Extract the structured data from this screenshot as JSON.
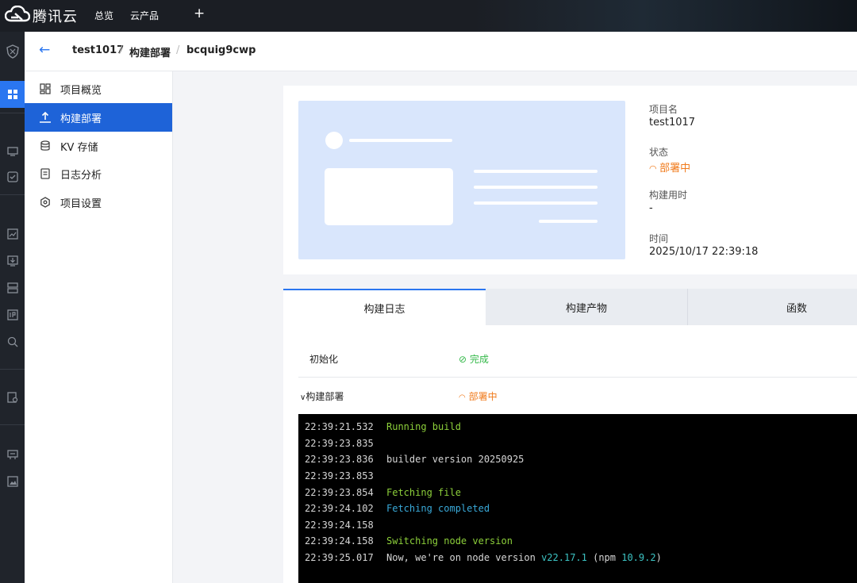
{
  "topbar": {
    "brand": "腾讯云",
    "nav": [
      "总览",
      "云产品"
    ],
    "plus": "+"
  },
  "header": {
    "breadcrumb": [
      "test1017",
      "构建部署",
      "bcquig9cwp"
    ]
  },
  "sidemenu": {
    "items": [
      {
        "label": "项目概览",
        "icon": "grid-icon"
      },
      {
        "label": "构建部署",
        "icon": "upload-icon",
        "active": true
      },
      {
        "label": "KV 存储",
        "icon": "database-icon"
      },
      {
        "label": "日志分析",
        "icon": "document-icon"
      },
      {
        "label": "项目设置",
        "icon": "gear-icon"
      }
    ]
  },
  "project": {
    "name_label": "项目名",
    "name_value": "test1017",
    "status_label": "状态",
    "status_value": "部署中",
    "build_time_label": "构建用时",
    "build_time_value": "-",
    "time_label": "时间",
    "time_value": "2025/10/17 22:39:18"
  },
  "tabs": [
    "构建日志",
    "构建产物",
    "函数"
  ],
  "stages": [
    {
      "name": "初始化",
      "status": "完成"
    },
    {
      "name": "构建部署",
      "status": "部署中"
    }
  ],
  "log": [
    {
      "time": "22:39:21.532",
      "parts": [
        {
          "t": "Running build",
          "c": "green"
        }
      ]
    },
    {
      "time": "22:39:23.835",
      "parts": []
    },
    {
      "time": "22:39:23.836",
      "parts": [
        {
          "t": "builder version 20250925",
          "c": "white"
        }
      ]
    },
    {
      "time": "22:39:23.853",
      "parts": []
    },
    {
      "time": "22:39:23.854",
      "parts": [
        {
          "t": "Fetching file",
          "c": "green"
        }
      ]
    },
    {
      "time": "22:39:24.102",
      "parts": [
        {
          "t": "Fetching completed",
          "c": "blue"
        }
      ]
    },
    {
      "time": "22:39:24.158",
      "parts": []
    },
    {
      "time": "22:39:24.158",
      "parts": [
        {
          "t": "Switching node version",
          "c": "green"
        }
      ]
    },
    {
      "time": "22:39:25.017",
      "parts": [
        {
          "t": "Now, we're on node version ",
          "c": "white"
        },
        {
          "t": "v22.17.1",
          "c": "cyan"
        },
        {
          "t": " (npm ",
          "c": "white"
        },
        {
          "t": "10.9.2",
          "c": "cyan"
        },
        {
          "t": ")",
          "c": "white"
        }
      ]
    }
  ],
  "colors": {
    "accent": "#2a76f0",
    "menu_active": "#1e63d8",
    "status_deploying": "#f07a1b",
    "status_done": "#35b94a"
  }
}
